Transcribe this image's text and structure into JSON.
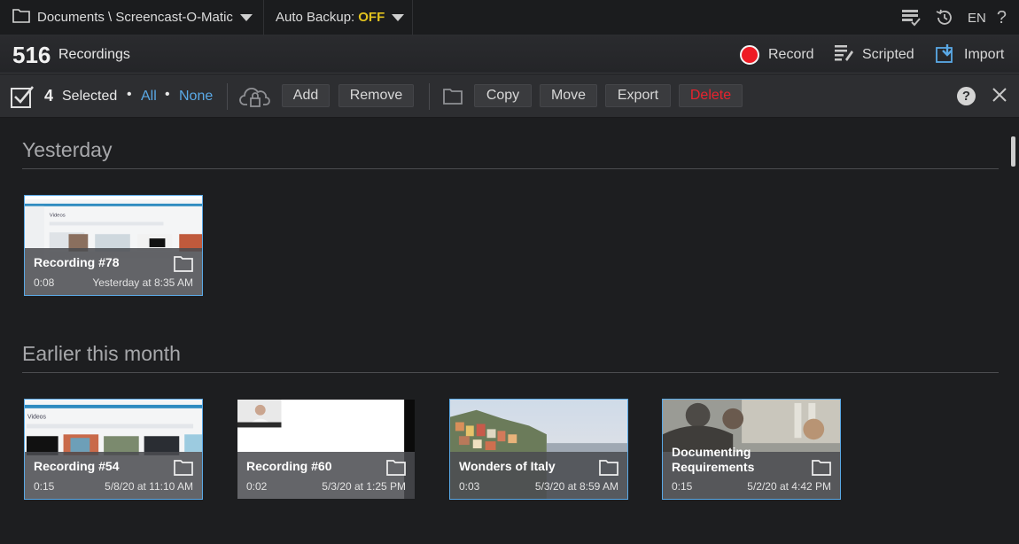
{
  "topbar": {
    "folder_path": "Documents \\ Screencast-O-Matic",
    "auto_backup_label": "Auto Backup:",
    "auto_backup_value": "OFF",
    "language": "EN",
    "help": "?"
  },
  "header": {
    "count": "516",
    "label": "Recordings",
    "record_label": "Record",
    "scripted_label": "Scripted",
    "import_label": "Import",
    "record_color": "#ee1b24"
  },
  "selection": {
    "count": "4",
    "label": "Selected",
    "all_label": "All",
    "none_label": "None",
    "add_label": "Add",
    "remove_label": "Remove",
    "copy_label": "Copy",
    "move_label": "Move",
    "export_label": "Export",
    "delete_label": "Delete",
    "help": "?"
  },
  "sections": [
    {
      "title": "Yesterday",
      "items": [
        {
          "title": "Recording #78",
          "duration": "0:08",
          "date": "Yesterday at 8:35 AM",
          "selected": true
        }
      ]
    },
    {
      "title": "Earlier this month",
      "items": [
        {
          "title": "Recording #54",
          "duration": "0:15",
          "date": "5/8/20 at 11:10 AM",
          "selected": true
        },
        {
          "title": "Recording #60",
          "duration": "0:02",
          "date": "5/3/20 at 1:25 PM",
          "selected": false
        },
        {
          "title": "Wonders of Italy",
          "duration": "0:03",
          "date": "5/3/20 at 8:59 AM",
          "selected": true
        },
        {
          "title": "Documenting Requirements",
          "duration": "0:15",
          "date": "5/2/20 at 4:42 PM",
          "selected": true
        }
      ]
    }
  ],
  "colors": {
    "accent": "#5aa9e6",
    "backup_off": "#e1c21e",
    "delete": "#e8232e"
  }
}
